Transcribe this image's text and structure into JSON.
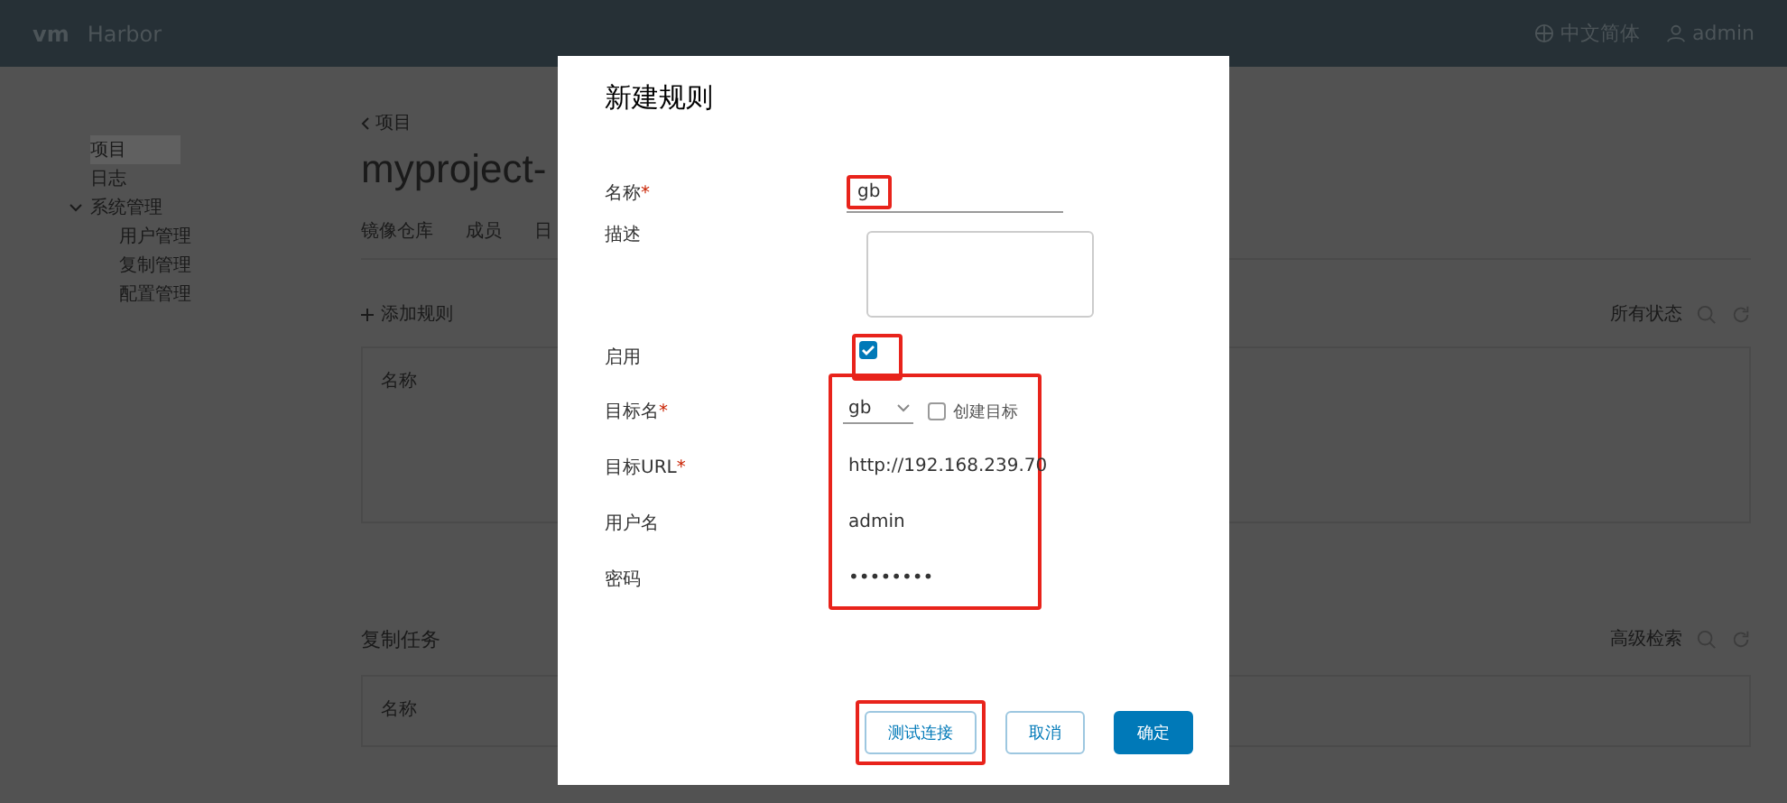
{
  "header": {
    "logo": "vm",
    "brand": "Harbor",
    "language": "中文简体",
    "user": "admin"
  },
  "sidebar": {
    "items": [
      {
        "label": "项目",
        "selected": true
      },
      {
        "label": "日志",
        "selected": false
      },
      {
        "label": "系统管理",
        "selected": false,
        "expanded": true,
        "children": [
          {
            "label": "用户管理",
            "selected": false
          },
          {
            "label": "复制管理",
            "selected": false
          },
          {
            "label": "配置管理",
            "selected": false
          }
        ]
      }
    ]
  },
  "main": {
    "breadcrumb": "项目",
    "title": "myproject-",
    "tabs": [
      {
        "label": "镜像仓库"
      },
      {
        "label": "成员"
      },
      {
        "label": "日"
      }
    ],
    "rules": {
      "add_label": "添加规则",
      "filter": "所有状态",
      "columns": [
        "名称"
      ]
    },
    "jobs": {
      "title": "复制任务",
      "search": "高级检索",
      "columns": [
        "名称"
      ]
    }
  },
  "dialog": {
    "title": "新建规则",
    "required_mark": "*",
    "fields": [
      {
        "kind": "text",
        "label": "名称",
        "required": true,
        "value": "gb",
        "highlighted": true
      },
      {
        "kind": "textarea",
        "label": "描述",
        "required": false
      },
      {
        "kind": "checkbox",
        "label": "启用",
        "required": false,
        "checked": true,
        "highlighted": true
      }
    ],
    "connection": {
      "highlighted": true,
      "fields": [
        {
          "kind": "select",
          "label": "目标名",
          "required": true,
          "value": "gb",
          "option": {
            "label": "创建目标",
            "checked": false
          }
        },
        {
          "kind": "plain",
          "label": "目标URL",
          "required": true,
          "value": "http://192.168.239.70"
        },
        {
          "kind": "plain",
          "label": "用户名",
          "required": false,
          "value": "admin"
        },
        {
          "kind": "plain",
          "label": "密码",
          "required": false,
          "value": "••••••••"
        }
      ]
    },
    "buttons": [
      {
        "label": "测试连接",
        "kind": "outline",
        "highlighted": true
      },
      {
        "label": "取消",
        "kind": "outline"
      },
      {
        "label": "确定",
        "kind": "primary"
      }
    ]
  }
}
